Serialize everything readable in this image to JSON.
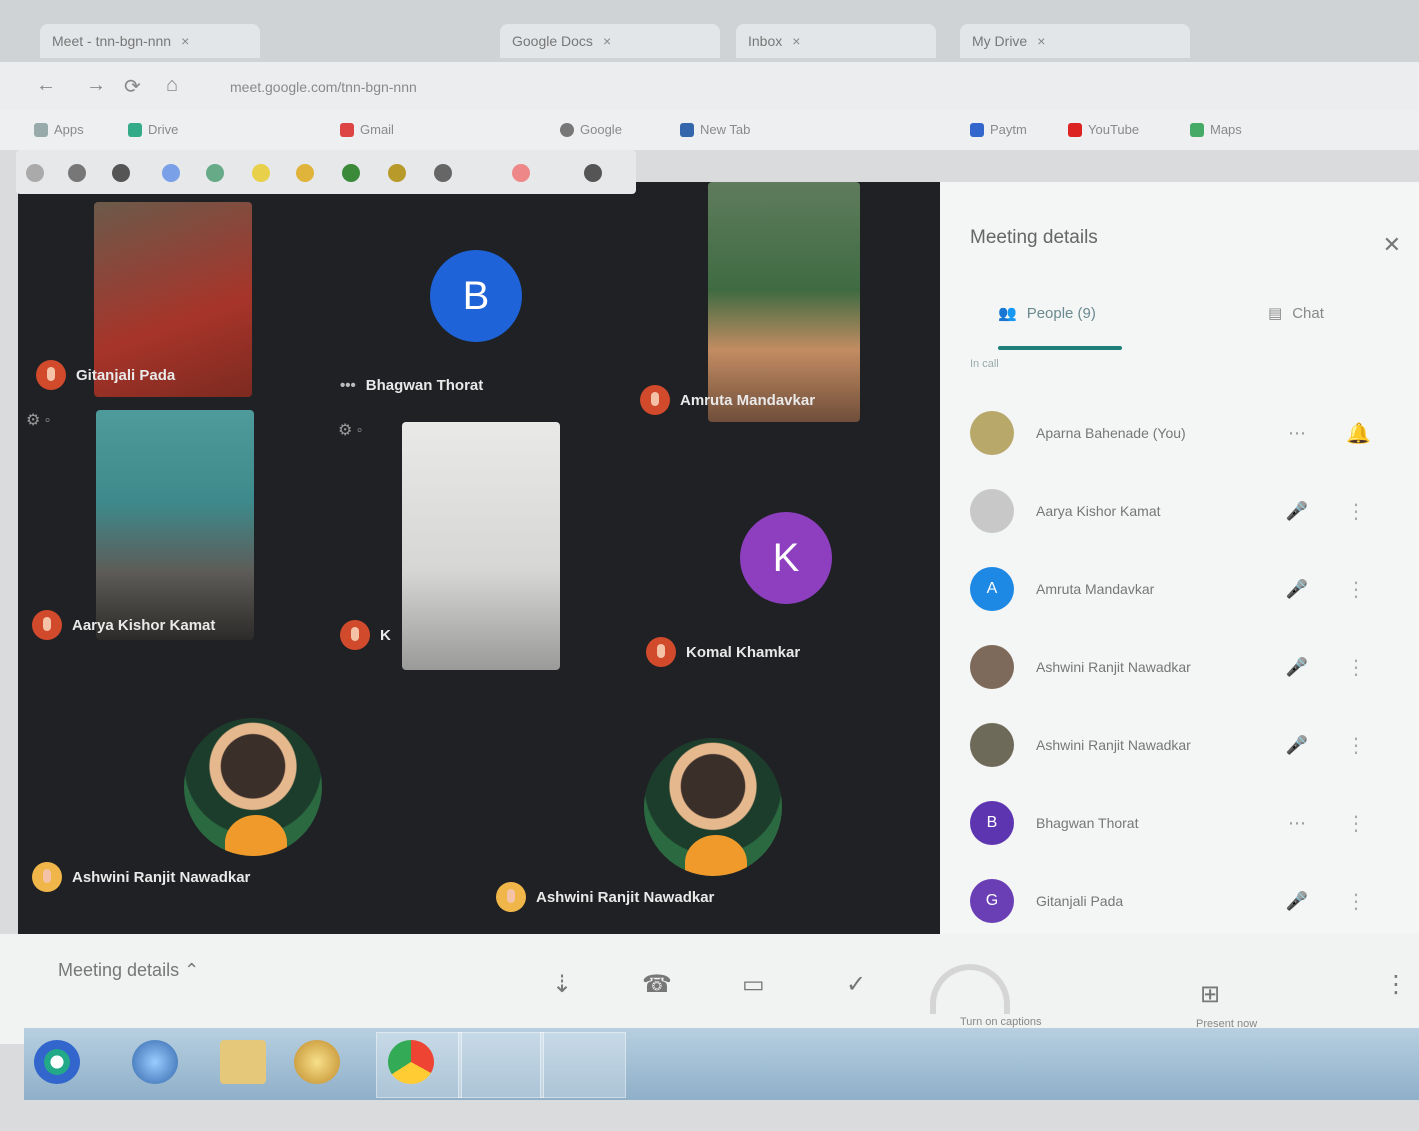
{
  "browser": {
    "tabs": [
      {
        "label": "Meet - tnn-bgn-nnn"
      },
      {
        "label": "Google Docs"
      },
      {
        "label": "Inbox"
      },
      {
        "label": "My Drive"
      }
    ],
    "address": "meet.google.com/tnn-bgn-nnn",
    "bookmarks": [
      "Apps",
      "Drive",
      "Gmail",
      "Google",
      "New Tab",
      "Paytm",
      "YouTube",
      "Maps"
    ]
  },
  "stage": {
    "participants": [
      {
        "name": "Gitanjali Pada"
      },
      {
        "name": "Bhagwan Thorat",
        "initial": "B"
      },
      {
        "name": "Amruta Mandavkar"
      },
      {
        "name": "Aarya Kishor Kamat"
      },
      {
        "name": "K"
      },
      {
        "name": "Komal Khamkar",
        "initial": "K"
      },
      {
        "name": "Ashwini Ranjit Nawadkar"
      },
      {
        "name": "Ashwini Ranjit Nawadkar"
      }
    ]
  },
  "panel": {
    "title": "Meeting details",
    "tab_people": "People (9)",
    "tab_chat": "Chat",
    "section": "In call",
    "people": [
      {
        "name": "Aparna Bahenade (You)",
        "initial": "",
        "color": "#b8a86a"
      },
      {
        "name": "Aarya Kishor Kamat",
        "initial": "",
        "color": "#c8c8c8"
      },
      {
        "name": "Amruta Mandavkar",
        "initial": "A",
        "color": "#1e88e5"
      },
      {
        "name": "Ashwini Ranjit Nawadkar",
        "initial": "",
        "color": "#7d6a5a"
      },
      {
        "name": "Ashwini Ranjit Nawadkar",
        "initial": "",
        "color": "#6e6a5a"
      },
      {
        "name": "Bhagwan Thorat",
        "initial": "B",
        "color": "#5e35b1"
      },
      {
        "name": "Gitanjali Pada",
        "initial": "G",
        "color": "#6a3fb5"
      }
    ]
  },
  "controls": {
    "meeting_details": "Meeting details",
    "captions_label": "Turn on captions",
    "present_label": "Present now"
  },
  "colors": {
    "stage_bg": "#1f2124",
    "avatar_b": "#1e63d8",
    "avatar_k": "#8e3fbf",
    "accent": "#1f7f7a"
  }
}
